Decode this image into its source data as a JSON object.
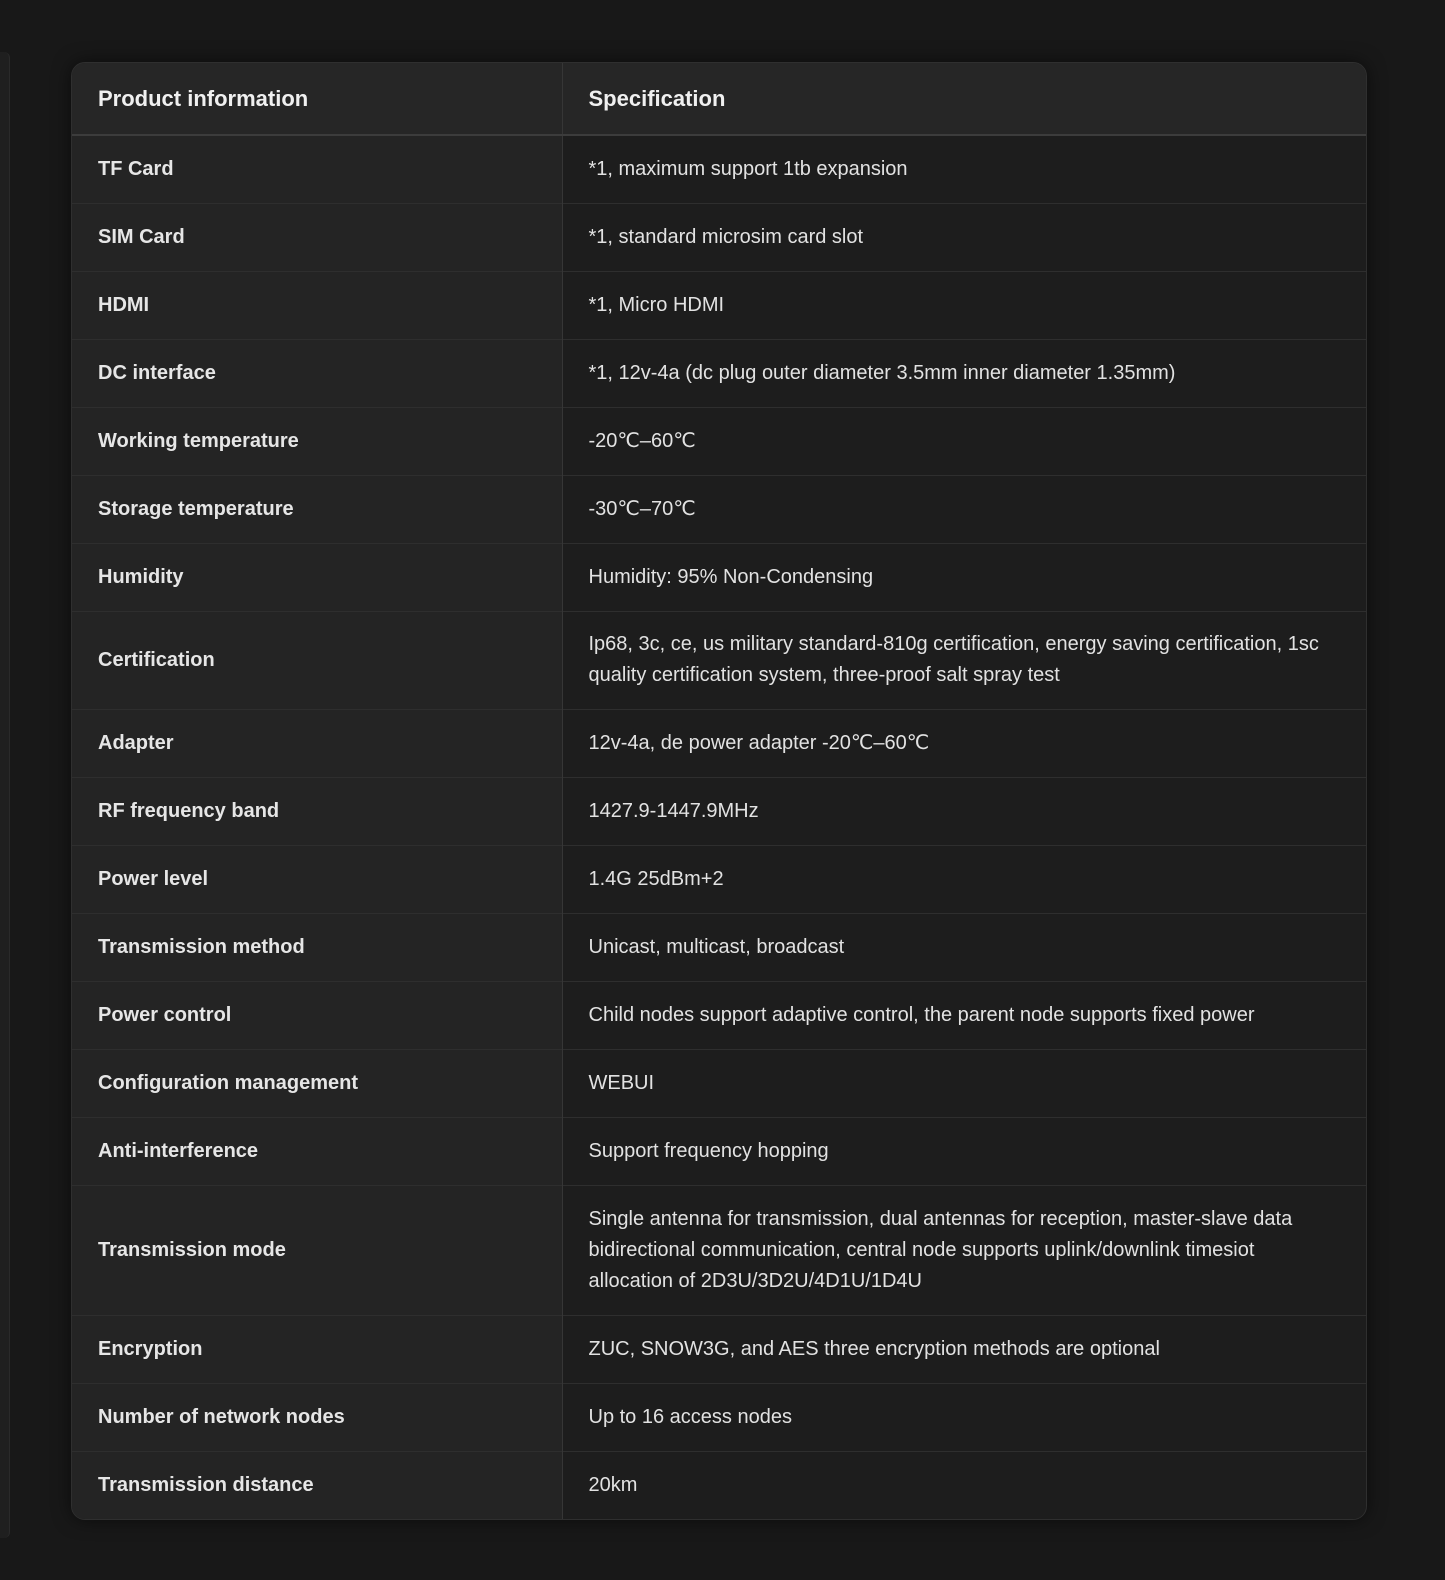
{
  "table": {
    "headers": [
      "Product information",
      "Specification"
    ],
    "rows": [
      {
        "key": "TF Card",
        "value": "*1, maximum support 1tb expansion",
        "lines": 1
      },
      {
        "key": "SIM Card",
        "value": "*1, standard microsim card slot",
        "lines": 1
      },
      {
        "key": "HDMI",
        "value": "*1, Micro HDMI",
        "lines": 1
      },
      {
        "key": "DC interface",
        "value": "*1, 12v-4a (dc plug outer diameter 3.5mm inner diameter 1.35mm)",
        "lines": 1
      },
      {
        "key": "Working temperature",
        "value": "-20℃–60℃",
        "lines": 1
      },
      {
        "key": "Storage temperature",
        "value": "-30℃–70℃",
        "lines": 1
      },
      {
        "key": "Humidity",
        "value": "Humidity: 95% Non-Condensing",
        "lines": 1
      },
      {
        "key": "Certification",
        "value": "Ip68, 3c, ce, us military standard-810g certification, energy saving certification, 1sc quality certification system, three-proof salt spray test",
        "lines": 2
      },
      {
        "key": "Adapter",
        "value": "12v-4a, de power adapter -20℃–60℃",
        "lines": 1
      },
      {
        "key": "RF frequency band",
        "value": "1427.9-1447.9MHz",
        "lines": 1
      },
      {
        "key": "Power level",
        "value": "1.4G 25dBm+2",
        "lines": 1
      },
      {
        "key": "Transmission method",
        "value": "Unicast, multicast, broadcast",
        "lines": 1
      },
      {
        "key": "Power control",
        "value": "Child nodes support adaptive control, the parent node supports fixed power",
        "lines": 1
      },
      {
        "key": "Configuration management",
        "value": "WEBUI",
        "lines": 1
      },
      {
        "key": "Anti-interference",
        "value": "Support frequency hopping",
        "lines": 1
      },
      {
        "key": "Transmission mode",
        "value": "Single antenna for transmission, dual antennas for reception, master-slave data bidirectional communication, central node supports uplink/downlink timesiot allocation of 2D3U/3D2U/4D1U/1D4U",
        "lines": 3
      },
      {
        "key": "Encryption",
        "value": "ZUC, SNOW3G, and AES three encryption methods are optional",
        "lines": 1
      },
      {
        "key": "Number of network nodes",
        "value": "Up to 16 access nodes",
        "lines": 1
      },
      {
        "key": "Transmission distance",
        "value": "20km",
        "lines": 1
      }
    ]
  },
  "colors": {
    "background": "#181818",
    "card": "#202020",
    "key_cell": "#242424",
    "value_cell": "#1d1d1d",
    "text": "#e6e6e6"
  }
}
